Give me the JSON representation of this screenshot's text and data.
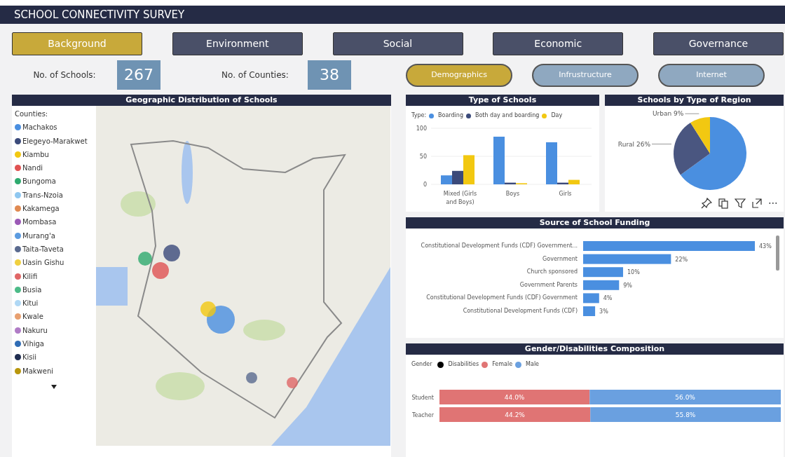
{
  "window": {
    "title": "SCHOOL CONNECTIVITY SURVEY"
  },
  "tabs": [
    {
      "label": "Background",
      "selected": true
    },
    {
      "label": "Environment",
      "selected": false
    },
    {
      "label": "Social",
      "selected": false
    },
    {
      "label": "Economic",
      "selected": false
    },
    {
      "label": "Governance",
      "selected": false
    }
  ],
  "stats": [
    {
      "label": "No. of Schools:",
      "value": "267"
    },
    {
      "label": "No. of Counties:",
      "value": "38"
    }
  ],
  "subtabs": [
    {
      "label": "Demographics",
      "selected": true
    },
    {
      "label": "Infrustructure",
      "selected": false
    },
    {
      "label": "Internet",
      "selected": false
    }
  ],
  "map": {
    "title": "Geographic Distribution of Schools",
    "legend_title": "Counties:",
    "legend": [
      {
        "name": "Machakos",
        "color": "#4a8fe0"
      },
      {
        "name": "Elegeyo-Marakwet",
        "color": "#3b4a7a"
      },
      {
        "name": "Kiambu",
        "color": "#f2c811"
      },
      {
        "name": "Nandi",
        "color": "#e05252"
      },
      {
        "name": "Bungoma",
        "color": "#2eaa6e"
      },
      {
        "name": "Trans-Nzoia",
        "color": "#8fc7f0"
      },
      {
        "name": "Kakamega",
        "color": "#e08a52"
      },
      {
        "name": "Mombasa",
        "color": "#9b59b6"
      },
      {
        "name": "Murang'a",
        "color": "#5b9be0"
      },
      {
        "name": "Taita-Taveta",
        "color": "#5a6a8f"
      },
      {
        "name": "Uasin Gishu",
        "color": "#f0d040"
      },
      {
        "name": "Kilifi",
        "color": "#e06666"
      },
      {
        "name": "Busia",
        "color": "#4cbb88"
      },
      {
        "name": "Kitui",
        "color": "#b0d8f5"
      },
      {
        "name": "Kwale",
        "color": "#e8a070"
      },
      {
        "name": "Nakuru",
        "color": "#b07cc6"
      },
      {
        "name": "Vihiga",
        "color": "#2f6cb5"
      },
      {
        "name": "Kisii",
        "color": "#1f2d50"
      },
      {
        "name": "Makweni",
        "color": "#b8960c"
      }
    ]
  },
  "type_of_schools": {
    "legend_title": "Type:",
    "chart_data": {
      "type": "bar",
      "title": "Type of Schools",
      "categories": [
        "Mixed (Girls and Boys)",
        "Boys",
        "Girls"
      ],
      "ylim": [
        0,
        100
      ],
      "yticks": [
        0,
        50,
        100
      ],
      "series": [
        {
          "name": "Boarding",
          "color": "#4a8fe0",
          "values": [
            16,
            85,
            75
          ]
        },
        {
          "name": "Both day and boarding",
          "color": "#3b4a7a",
          "values": [
            24,
            3,
            3
          ]
        },
        {
          "name": "Day",
          "color": "#f2c811",
          "values": [
            52,
            2,
            8
          ]
        }
      ]
    }
  },
  "schools_by_region": {
    "chart_data": {
      "type": "pie",
      "title": "Schools by Type of Region",
      "values": [
        65,
        26,
        9
      ],
      "colors": [
        "#4a8fe0",
        "#4a5680",
        "#f2c811"
      ],
      "value_labels": [
        null,
        "Rural 26%",
        "Urban 9%"
      ]
    },
    "more_glyph": "⋯"
  },
  "funding": {
    "chart_data": {
      "type": "bar",
      "orientation": "horizontal",
      "title": "Source of School Funding",
      "categories": [
        "Constitutional Development Funds (CDF) Government...",
        "Government",
        "Church sponsored",
        "Government Parents",
        "Constitutional Development Funds (CDF) Government",
        "Constitutional Development Funds (CDF)"
      ],
      "values": [
        43,
        22,
        10,
        9,
        4,
        3
      ],
      "colors": [
        "#4a8fe0",
        "#4a8fe0",
        "#4a8fe0",
        "#4a8fe0",
        "#4a8fe0",
        "#4a8fe0"
      ],
      "value_labels": [
        "43%",
        "22%",
        "10%",
        "9%",
        "4%",
        "3%"
      ]
    }
  },
  "gender": {
    "legend_title": "Gender",
    "chart_data": {
      "type": "bar",
      "orientation": "horizontal",
      "stacked": true,
      "title": "Gender/Disabilities Composition",
      "categories": [
        "Student",
        "Teacher"
      ],
      "series": [
        {
          "name": "Disabilities",
          "color": "#000000",
          "values": [
            null,
            null
          ]
        },
        {
          "name": "Female",
          "color": "#e07474",
          "values": [
            44.0,
            44.2
          ],
          "value_labels": [
            "44.0%",
            "44.2%"
          ]
        },
        {
          "name": "Male",
          "color": "#6aa0e0",
          "values": [
            56.0,
            55.8
          ],
          "value_labels": [
            "56.0%",
            "55.8%"
          ]
        }
      ]
    }
  }
}
